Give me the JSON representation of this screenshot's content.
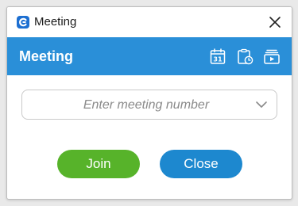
{
  "window": {
    "title": "Meeting"
  },
  "header": {
    "title": "Meeting",
    "icons": [
      "calendar-icon",
      "schedule-icon",
      "recordings-icon"
    ],
    "calendar_day": "31"
  },
  "meeting_input": {
    "placeholder": "Enter meeting number"
  },
  "buttons": {
    "join_label": "Join",
    "close_label": "Close"
  },
  "colors": {
    "header_bg": "#2a8fd8",
    "join_bg": "#57b32a",
    "close_bg": "#1d88cf"
  }
}
